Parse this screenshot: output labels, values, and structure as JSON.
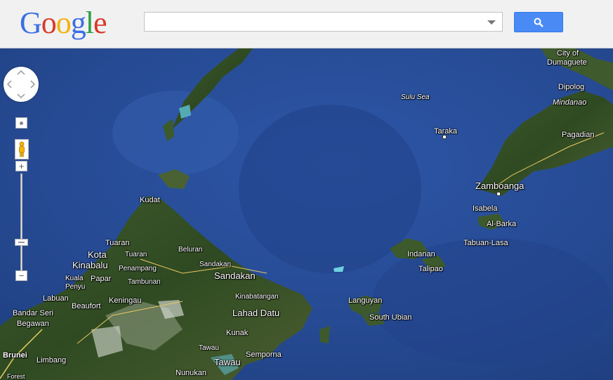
{
  "header": {
    "logo": {
      "letters": [
        "G",
        "o",
        "o",
        "g",
        "l",
        "e"
      ],
      "colors": [
        "#3b6ee6",
        "#d93a2b",
        "#f2b20b",
        "#3b6ee6",
        "#2f9e44",
        "#d93a2b"
      ]
    },
    "search": {
      "value": "",
      "placeholder": ""
    },
    "search_button_icon": "search-icon",
    "dropdown_icon": "chevron-down-icon",
    "accent": "#4a8af4"
  },
  "controls": {
    "pan_icon": "pan-arrows-icon",
    "zoom_in": "+",
    "zoom_out": "−",
    "pegman_icon": "pegman-icon"
  },
  "labels": {
    "city_of_dumaguete_1": "City of",
    "city_of_dumaguete_2": "Dumaguete",
    "sulu_sea": "Sulu Sea",
    "dipolog": "Dipolog",
    "mindanao": "Mindanao",
    "taraka": "Taraka",
    "pagadian": "Pagadian",
    "zamboanga": "Zamboanga",
    "isabela": "Isabela",
    "al_barka": "Al-Barka",
    "tabuan_lasa": "Tabuan-Lasa",
    "indanan": "Indanan",
    "talipao": "Talipao",
    "kudat": "Kudat",
    "tuaran_1": "Tuaran",
    "tuaran_2": "Tuaran",
    "kota_kinabalu_1": "Kota",
    "kota_kinabalu_2": "Kinabalu",
    "beluran": "Beluran",
    "sandakan_small": "Sandakan",
    "sandakan": "Sandakan",
    "penampang": "Penampang",
    "kuala_penyu_1": "Kuala",
    "kuala_penyu_2": "Penyu",
    "papar": "Papar",
    "tambunan": "Tambunan",
    "labuan": "Labuan",
    "beaufort": "Beaufort",
    "keningau": "Keningau",
    "kinabatangan": "Kinabatangan",
    "lahad_datu": "Lahad Datu",
    "bandar_seri_1": "Bandar Seri",
    "bandar_seri_2": "Begawan",
    "kunak": "Kunak",
    "tawau_small": "Tawau",
    "semporna": "Semporna",
    "tawau": "Tawau",
    "brunei": "Brunei",
    "limbang": "Limbang",
    "nunukan": "Nunukan",
    "languyan": "Languyan",
    "south_ubian": "South Ubian",
    "forest": "Forest"
  }
}
